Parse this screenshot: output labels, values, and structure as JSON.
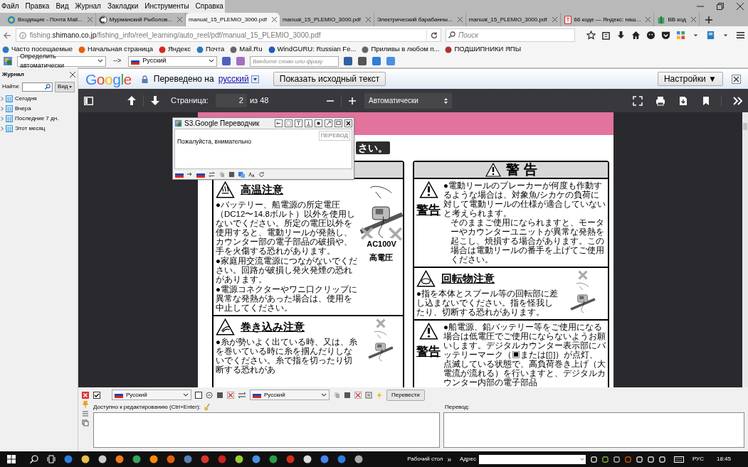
{
  "menu_bar": [
    "Файл",
    "Правка",
    "Вид",
    "Журнал",
    "Закладки",
    "Инструменты",
    "Справка"
  ],
  "tabs": [
    {
      "label": "Входящие - Почта Mail...",
      "selected": false,
      "favicon": true
    },
    {
      "label": "Мурманский Рыболов...",
      "selected": false,
      "favicon": true
    },
    {
      "label": "manual_15_PLEMIO_3000.pdf",
      "selected": true,
      "favicon": false
    },
    {
      "label": "manual_15_PLEMIO_3000.pdf",
      "selected": false,
      "favicon": false
    },
    {
      "label": "Электрический барабанны...",
      "selected": false,
      "favicon": false
    },
    {
      "label": "manual_15_PLEMIO_3000.pdf",
      "selected": false,
      "favicon": false
    },
    {
      "label": "66 коде — Яндекс: наш...",
      "selected": false,
      "favicon": true
    },
    {
      "label": "BB код",
      "selected": false,
      "favicon": true
    }
  ],
  "address_bar": {
    "subdomain": "fishing.",
    "domain": "shimano.co.jp",
    "path": "/fishing_info/reel_learning/auto_reel/pdf/manual_15_PLEMIO_3000.pdf"
  },
  "search_field": {
    "placeholder": "Поиск"
  },
  "bookmarks": [
    "Часто посещаемые",
    "Начальная страница",
    "Яндекс",
    "Почта",
    "Mail.Ru",
    "WindGURU: Russian Fe...",
    "Приливы в любом п...",
    "ПОДШИПНИКИ ЯПЫ"
  ],
  "s3_toolbar": {
    "source_language": "Определить автоматически",
    "arrow": "-->",
    "target_language": "Русский",
    "placeholder": "Введите слово или фразу"
  },
  "history_sidebar": {
    "title": "Журнал",
    "find_label": "Найти:",
    "view_button": "Вид",
    "groups": [
      "Сегодня",
      "Вчера",
      "Последние 7 дн.",
      "Этот месяц"
    ]
  },
  "translate_bar": {
    "logo": "Google",
    "translated_to": "Переведено на",
    "language": "русский",
    "show_original": "Показать исходный текст",
    "settings": "Настройки ▼"
  },
  "pdf_toolbar": {
    "page_label": "Страница:",
    "page": "2",
    "page_count": "из 48",
    "zoom": "Автоматически"
  },
  "pdf_page": {
    "heading_fragment": "さい。",
    "left_column": [
      {
        "kind": "heat",
        "title": "高温注意",
        "paragraphs": [
          "●バッテリー、船電源の所定電圧（DC12〜14.8ボルト）以外を使用しないでください。所定の電圧以外を使用すると、電動リールが発熱し、カウンター部の電子部品の破損や、手を火傷する恐れがあります。",
          "●家庭用交流電源につながないでください。回路が破損し発火発煙の恐れがあります。",
          "●電源コネクターやワニ口クリップに異常な発熱があった場合は、使用を中止してください。"
        ],
        "figure_labels": [
          "AC100V",
          "高電圧"
        ]
      },
      {
        "kind": "entanglement",
        "title": "巻き込み注意",
        "paragraphs": [
          "●糸が勢いよく出ている時、又は、糸を巻いている時に糸を掴んだりしないでください。糸で指を切ったり切断する恐れがあ"
        ]
      }
    ],
    "right_column": {
      "header": "警 告",
      "sections": [
        {
          "kind": "warning",
          "label": "警告",
          "paragraphs": [
            "●電動リールのブレーカーが何度も作動するような場合は、対象魚/シカケの負荷に対して電動リールの仕様が適合していないと考えられます。",
            "そのままご使用になられますと、モーターやカウンターユニットが異常な発熱を起こし、焼損する場合があります。この場合は電動リールの番手を上げてご使用ください。"
          ]
        },
        {
          "kind": "rotation",
          "title": "回転物注意",
          "paragraphs": [
            "●指を本体とスプール等の回転部に差し込まないでください。指を怪我したり、切断する恐れがあります。"
          ]
        },
        {
          "kind": "warning",
          "label": "警告",
          "paragraphs": [
            "●船電源、鉛バッテリー等をご使用になる場合は低電圧でご使用にならないようお願いします。デジタルカウンター表示部にバッテリーマーク（▣または[▯]）が点灯、点滅している状態で、高負荷巻き上げ（大電流が流れる）を行いますと、デジタルカウンター内部の電子部品"
          ]
        }
      ]
    }
  },
  "popup": {
    "title": "S3.Google Переводчик",
    "badge": "ПЕРЕВОД",
    "text": "Пожалуйста, внимательно"
  },
  "translator_panel": {
    "checkboxes": [
      {
        "checked": true
      },
      {
        "checked": false
      }
    ],
    "source_language": "Русский",
    "target_language": "Русский",
    "translate_button": "Перевести",
    "source_label": "Доступно к редактированию (Ctrl+Enter):",
    "target_label": "Перевод:"
  },
  "taskbar": {
    "desktop_label": "Рабочий стол",
    "chevron": "»",
    "address_label": "Адрес",
    "language": "РУС",
    "time": "18:45"
  }
}
